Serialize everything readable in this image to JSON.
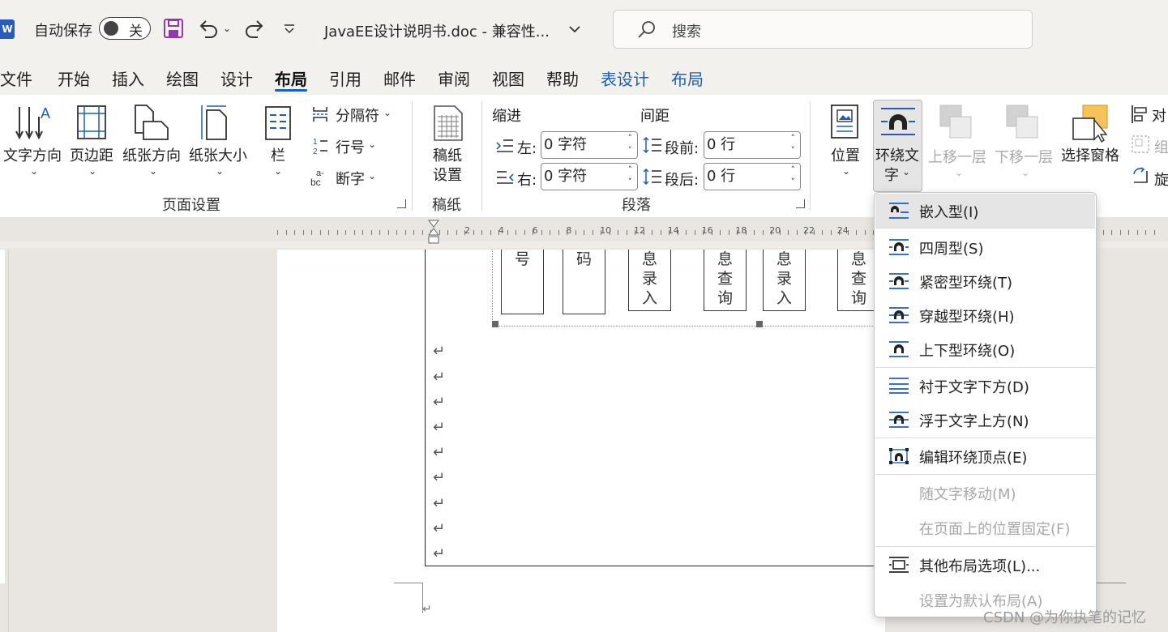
{
  "titlebar": {
    "app_icon": "W",
    "autosave_label": "自动保存",
    "autosave_state": "关",
    "doc_title": "JavaEE设计说明书.doc  -  兼容性...",
    "search_placeholder": "搜索"
  },
  "tabs": [
    "文件",
    "开始",
    "插入",
    "绘图",
    "设计",
    "布局",
    "引用",
    "邮件",
    "审阅",
    "视图",
    "帮助",
    "表设计",
    "布局"
  ],
  "active_tab": "布局",
  "ribbon": {
    "text_direction": "文字方向",
    "margins": "页边距",
    "orientation": "纸张方向",
    "size": "纸张大小",
    "columns": "栏",
    "breaks": "分隔符",
    "line_numbers": "行号",
    "hyphenation": "断字",
    "page_setup_group": "页面设置",
    "manuscript_btn_1": "稿纸",
    "manuscript_btn_2": "设置",
    "manuscript_group": "稿纸",
    "indent_header": "缩进",
    "spacing_header": "间距",
    "indent_left_label": "左:",
    "indent_left_value": "0 字符",
    "indent_right_label": "右:",
    "indent_right_value": "0 字符",
    "spacing_before_label": "段前:",
    "spacing_before_value": "0 行",
    "spacing_after_label": "段后:",
    "spacing_after_value": "0 行",
    "paragraph_group": "段落",
    "position": "位置",
    "wrap_text_1": "环绕文",
    "wrap_text_2": "字",
    "bring_forward": "上移一层",
    "send_backward": "下移一层",
    "selection_pane": "选择窗格",
    "align_partial": "对",
    "group_partial": "组",
    "rotate_partial": "旋"
  },
  "ruler_numbers": [
    "2",
    "4",
    "6",
    "8",
    "10",
    "12",
    "14",
    "16",
    "18",
    "20",
    "22",
    "24"
  ],
  "document": {
    "boxes": [
      [
        "号"
      ],
      [
        "码"
      ],
      [
        "息",
        "录",
        "入"
      ],
      [
        "息",
        "查",
        "询"
      ],
      [
        "息",
        "录",
        "入"
      ],
      [
        "息",
        "查",
        "询"
      ]
    ],
    "para_mark": "↵"
  },
  "wrap_menu": {
    "items": [
      {
        "label": "嵌入型(I)",
        "enabled": true,
        "icon": "inline-icon"
      },
      {
        "label": "四周型(S)",
        "enabled": true,
        "icon": "square-wrap-icon"
      },
      {
        "label": "紧密型环绕(T)",
        "enabled": true,
        "icon": "tight-wrap-icon"
      },
      {
        "label": "穿越型环绕(H)",
        "enabled": true,
        "icon": "through-wrap-icon"
      },
      {
        "label": "上下型环绕(O)",
        "enabled": true,
        "icon": "top-bottom-wrap-icon"
      },
      {
        "label": "衬于文字下方(D)",
        "enabled": true,
        "icon": "behind-text-icon"
      },
      {
        "label": "浮于文字上方(N)",
        "enabled": true,
        "icon": "in-front-text-icon"
      },
      {
        "label": "编辑环绕顶点(E)",
        "enabled": true,
        "icon": "edit-wrap-points-icon"
      },
      {
        "label": "随文字移动(M)",
        "enabled": false
      },
      {
        "label": "在页面上的位置固定(F)",
        "enabled": false
      },
      {
        "label": "其他布局选项(L)...",
        "enabled": true,
        "icon": "more-layout-icon"
      },
      {
        "label": "设置为默认布局(A)",
        "enabled": false
      }
    ]
  },
  "watermark": "CSDN @为你执笔的记忆",
  "colors": {
    "accent": "#1e5fb3",
    "ribbon_bg": "#ffffff",
    "chrome_bg": "#f3f1ee",
    "canvas_bg": "#e9e6e2"
  }
}
